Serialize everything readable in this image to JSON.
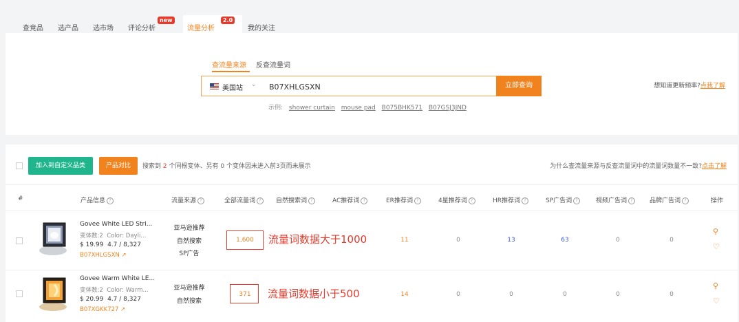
{
  "tabs": [
    {
      "label": "查竞品"
    },
    {
      "label": "选产品"
    },
    {
      "label": "选市场"
    },
    {
      "label": "评论分析",
      "badge": "new"
    },
    {
      "label": "流量分析",
      "badge": "2.0",
      "active": true
    },
    {
      "label": "我的关注"
    }
  ],
  "search": {
    "tabs": [
      "查流量来源",
      "反查流量词"
    ],
    "site": "美国站",
    "value": "B07XHLGSXN",
    "button": "立即查询",
    "examples_label": "示例:",
    "examples": [
      "shower curtain",
      "mouse pad",
      "B075BHK571",
      "B07GSJ3JND"
    ],
    "hint": "想知道更新频率?",
    "hint_link": "点我了解"
  },
  "toolbar": {
    "add_button": "加入到自定义品类",
    "compare_button": "产品对比",
    "summary_prefix": "搜索到",
    "summary_count": "2",
    "summary_suffix": "个同根变体、另有 0 个变体因未进入前3页而未展示",
    "why": "为什么查流量来源与反查流量词中的流量词数量不一致?",
    "why_link": "点击了解"
  },
  "columns": [
    "#",
    "产品信息",
    "流量来源",
    "全部流量词",
    "自然搜索词",
    "AC推荐词",
    "ER推荐词",
    "4星推荐词",
    "HR推荐词",
    "SP广告词",
    "视频广告词",
    "品牌广告词",
    "操作"
  ],
  "rows": [
    {
      "name": "Govee White LED Stri...",
      "variants": "变体数:2",
      "color": "Color: Dayli...",
      "price": "$ 19.99",
      "rating": "4.7 / 8,327",
      "asin": "B07XHLGSXN",
      "sources": [
        "亚马逊推荐",
        "自然搜索",
        "SP广告"
      ],
      "values": [
        "1,600",
        "",
        "",
        "11",
        "0",
        "13",
        "63",
        "0",
        "0"
      ],
      "annotation": "流量词数据大于1000"
    },
    {
      "name": "Govee Warm White LE...",
      "variants": "变体数:2",
      "color": "Color: Warm...",
      "price": "$ 20.99",
      "rating": "4.7 / 8,327",
      "asin": "B07XGKK727",
      "sources": [
        "亚马逊推荐",
        "自然搜索"
      ],
      "values": [
        "371",
        "",
        "",
        "14",
        "0",
        "0",
        "0",
        "0",
        "0"
      ],
      "annotation": "流量词数据小于500"
    }
  ],
  "colors": {
    "accent": "#f0831e",
    "green": "#21b58e",
    "red": "#e53b2c",
    "blue": "#3b5bdb"
  },
  "icons": {
    "search": "search-icon",
    "heart": "heart-icon",
    "external": "external-link-icon",
    "help": "help-icon"
  }
}
